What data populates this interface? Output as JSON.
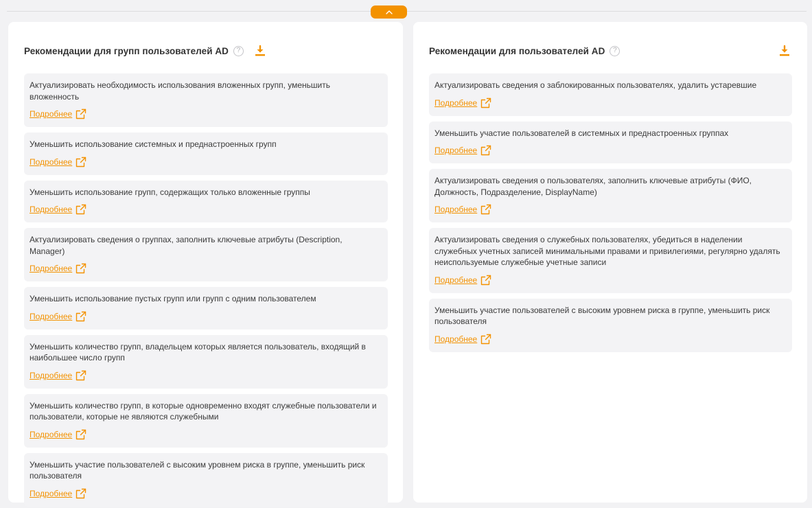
{
  "colors": {
    "accent": "#f39200",
    "card_bg": "#f3f3f5",
    "page_bg": "#f2f2f4"
  },
  "icons": {
    "toggle": "chevron-up-icon",
    "help": "question-icon",
    "download": "download-icon",
    "external": "external-link-icon"
  },
  "left_panel": {
    "title": "Рекомендации для групп пользователей AD",
    "help_glyph": "?",
    "cards": [
      {
        "text": "Актуализировать необходимость использования вложенных групп, уменьшить вложенность",
        "link": "Подробнее"
      },
      {
        "text": "Уменьшить использование системных и преднастроенных групп",
        "link": "Подробнее"
      },
      {
        "text": "Уменьшить использование групп, содержащих только вложенные группы",
        "link": "Подробнее"
      },
      {
        "text": "Актуализировать сведения о группах, заполнить ключевые атрибуты (Description, Manager)",
        "link": "Подробнее"
      },
      {
        "text": "Уменьшить использование пустых групп или групп с одним пользователем",
        "link": "Подробнее"
      },
      {
        "text": "Уменьшить количество групп, владельцем которых является пользователь, входящий в наибольшее число групп",
        "link": "Подробнее"
      },
      {
        "text": "Уменьшить количество групп, в которые одновременно входят служебные пользователи и пользователи, которые не являются служебными",
        "link": "Подробнее"
      },
      {
        "text": "Уменьшить участие пользователей с высоким уровнем риска в группе, уменьшить риск пользователя",
        "link": "Подробнее"
      }
    ]
  },
  "right_panel": {
    "title": "Рекомендации для пользователей AD",
    "help_glyph": "?",
    "cards": [
      {
        "text": "Актуализировать сведения о заблокированных пользователях, удалить устаревшие",
        "link": "Подробнее"
      },
      {
        "text": "Уменьшить участие пользователей в системных и преднастроенных группах",
        "link": "Подробнее"
      },
      {
        "text": "Актуализировать сведения о пользователях, заполнить ключевые атрибуты (ФИО, Должность, Подразделение, DisplayName)",
        "link": "Подробнее"
      },
      {
        "text": "Актуализировать сведения о служебных пользователях, убедиться в наделении служебных учетных записей минимальными правами и привилегиями, регулярно удалять неиспользуемые служебные учетные записи",
        "link": "Подробнее"
      },
      {
        "text": "Уменьшить участие пользователей с высоким уровнем риска в группе, уменьшить риск пользователя",
        "link": "Подробнее"
      }
    ]
  }
}
